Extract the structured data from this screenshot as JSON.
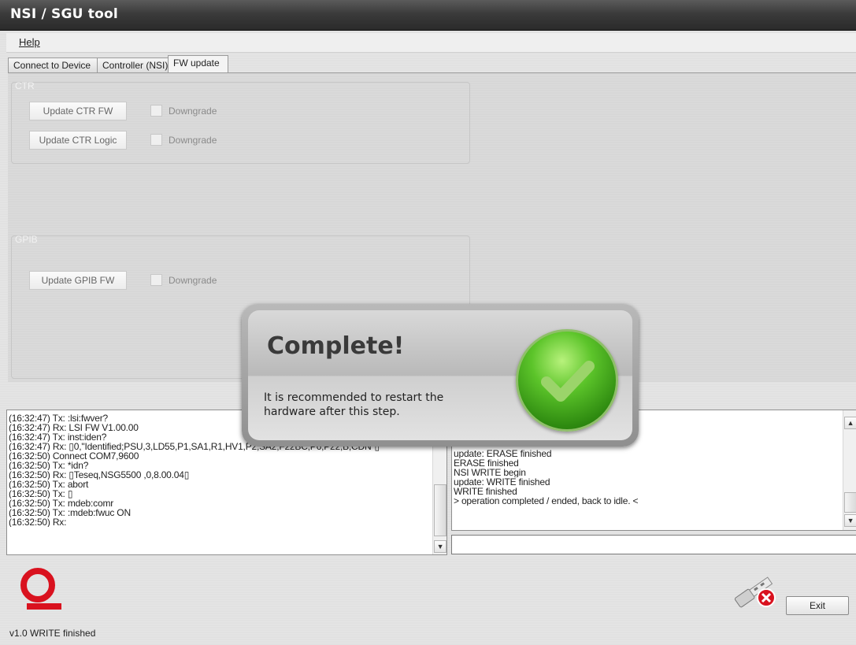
{
  "window": {
    "title": "NSI / SGU tool"
  },
  "menu": {
    "help": "Help"
  },
  "tabs": [
    {
      "label": "Connect to Device",
      "active": false
    },
    {
      "label": "Controller (NSI)",
      "active": false
    },
    {
      "label": "FW update",
      "active": true
    }
  ],
  "ctr_group": {
    "title": "CTR",
    "update_fw_button": "Update CTR FW",
    "update_logic_button": "Update CTR Logic",
    "downgrade_label_1": "Downgrade",
    "downgrade_label_2": "Downgrade"
  },
  "gpib_group": {
    "title": "GPIB",
    "update_fw_button": "Update GPIB FW",
    "downgrade_label": "Downgrade"
  },
  "left_log": [
    "(16:32:47) Tx: :lsi:fwver?",
    "(16:32:47) Rx: LSI FW V1.00.00",
    "(16:32:47) Tx: inst:iden?",
    "(16:32:47) Rx: ▯0,\"Identified;PSU,3,LD55,P1,SA1,R1,HV1,P2,SA2,F22BC,P6,P22,B,CDN\"▯",
    "(16:32:50) Connect COM7,9600",
    "(16:32:50) Tx: *idn?",
    "(16:32:50) Rx: ▯Teseq,NSG5500 ,0,8.00.04▯",
    "(16:32:50) Tx: abort",
    "(16:32:50) Tx: ▯",
    "(16:32:50) Tx: mdeb:comr",
    "(16:32:50) Tx: :mdeb:fwuc ON",
    "(16:32:50) Rx:"
  ],
  "right_log": [
    "update: ERASE finished",
    "ERASE finished",
    "NSI WRITE begin",
    "update: WRITE finished",
    "WRITE finished",
    "> operation completed / ended, back to idle. <"
  ],
  "popup": {
    "title": "Complete!",
    "message": "It is recommended to restart the hardware after this step.",
    "icon": "check-icon"
  },
  "footer": {
    "exit_button": "Exit",
    "status_text": "v1.0  WRITE finished",
    "logo": "brand-logo-icon",
    "usb_status_icon": "usb-disconnected-icon"
  },
  "colors": {
    "brand_red": "#d9121f",
    "titlebar": "#3b3b3b",
    "success_green": "#3ea818"
  }
}
